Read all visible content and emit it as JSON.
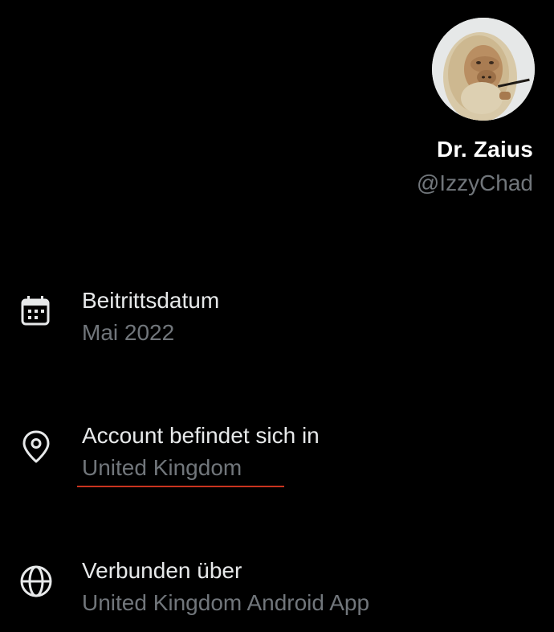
{
  "profile": {
    "display_name": "Dr. Zaius",
    "handle": "@IzzyChad"
  },
  "details": {
    "joined": {
      "label": "Beitrittsdatum",
      "value": "Mai 2022",
      "icon": "calendar-icon"
    },
    "location": {
      "label": "Account befindet sich in",
      "value": "United Kingdom",
      "icon": "location-pin-icon"
    },
    "connected": {
      "label": "Verbunden über",
      "value": "United Kingdom Android App",
      "icon": "globe-icon"
    }
  },
  "colors": {
    "background": "#000000",
    "primary_text": "#e7e9ea",
    "secondary_text": "#71767b",
    "underline": "#c9341f"
  }
}
